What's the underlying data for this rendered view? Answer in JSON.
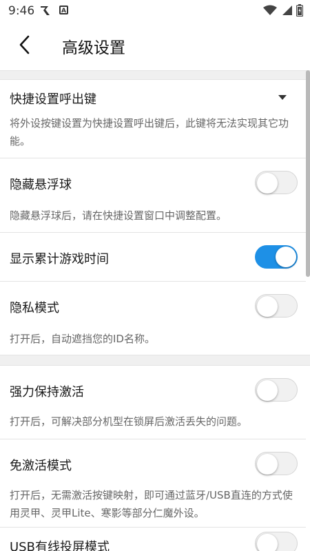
{
  "status_bar": {
    "time": "9:46",
    "icons": [
      "r-app-icon",
      "a-app-icon",
      "wifi-icon",
      "signal-icon",
      "battery-icon"
    ]
  },
  "header": {
    "title": "高级设置",
    "back_icon": "chevron-left-icon"
  },
  "settings": {
    "hotkey": {
      "title": "快捷设置呼出键",
      "desc": "将外设按键设置为快捷设置呼出键后，此键将无法实现其它功能。"
    },
    "hide_ball": {
      "title": "隐藏悬浮球",
      "desc": "隐藏悬浮球后，请在快捷设置窗口中调整配置。",
      "enabled": false
    },
    "show_time": {
      "title": "显示累计游戏时间",
      "enabled": true
    },
    "privacy": {
      "title": "隐私模式",
      "desc": "打开后，自动遮挡您的ID名称。",
      "enabled": false
    },
    "keep_alive": {
      "title": "强力保持激活",
      "desc": "打开后，可解决部分机型在锁屏后激活丢失的问题。",
      "enabled": false
    },
    "no_activation": {
      "title": "免激活模式",
      "desc": "打开后，无需激活按键映射，即可通过蓝牙/USB直连的方式使用灵甲、灵甲Lite、寒影等部分仁魔外设。",
      "enabled": false
    },
    "usb_cast": {
      "title": "USB有线投屏模式",
      "enabled": false
    }
  },
  "colors": {
    "accent": "#1e90e6",
    "band": "#f0f0f0"
  }
}
